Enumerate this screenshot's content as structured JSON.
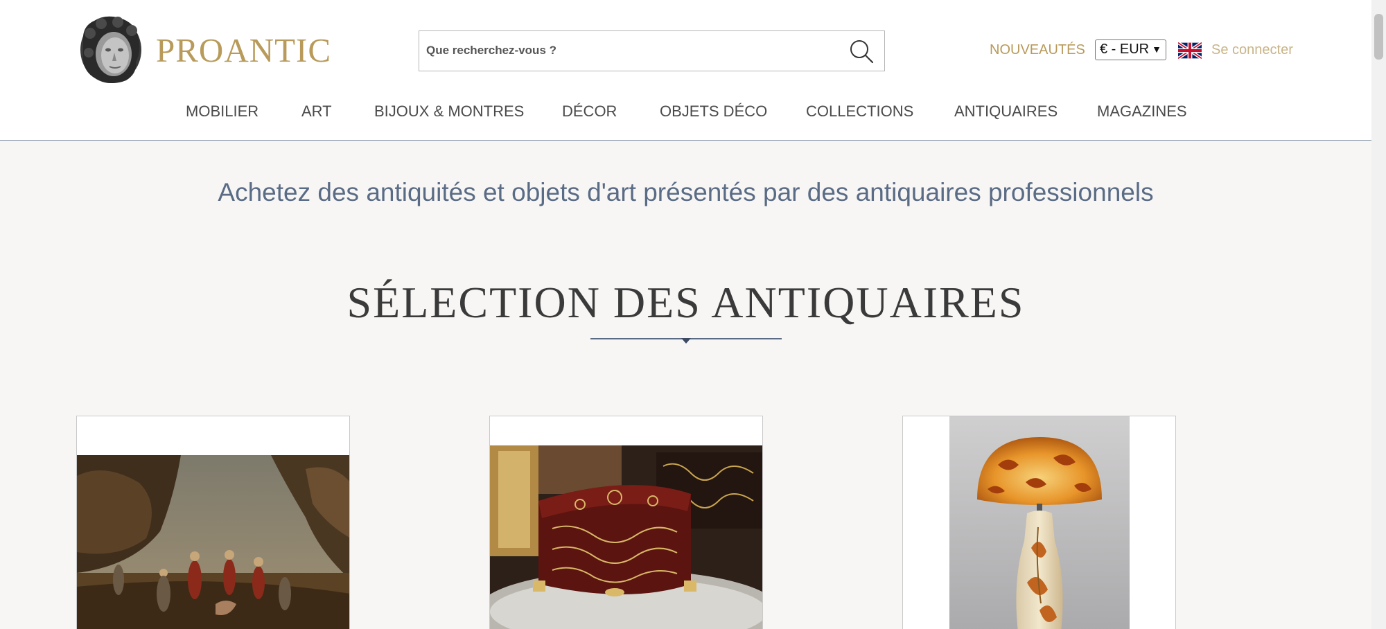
{
  "header": {
    "logo_text": "PROANTIC",
    "search_placeholder": "Que recherchez-vous ?",
    "new_label": "NOUVEAUTÉS",
    "currency_value": "€ - EUR",
    "login_label": "Se connecter",
    "icons": {
      "logo": "cherub-head-logo",
      "search": "search-icon",
      "flag": "uk-flag-icon",
      "select": "chevron-down-icon"
    }
  },
  "nav": {
    "items": [
      "MOBILIER",
      "ART",
      "BIJOUX & MONTRES",
      "DÉCOR",
      "OBJETS DÉCO",
      "COLLECTIONS",
      "ANTIQUAIRES",
      "MAGAZINES"
    ]
  },
  "main": {
    "tagline": "Achetez des antiquités et objets d'art présentés par des antiquaires professionnels",
    "section_title": "SÉLECTION DES ANTIQUAIRES",
    "cards": [
      {
        "name": "painting-card",
        "subject": "old master landscape painting"
      },
      {
        "name": "boulle-box-card",
        "subject": "boulle marquetry box"
      },
      {
        "name": "galle-lamp-card",
        "subject": "cameo glass mushroom lamp"
      }
    ]
  },
  "colors": {
    "brand_gold": "#b89a5a",
    "login_gold": "#c8b488",
    "tagline_blue": "#5a6b85",
    "background": "#f7f6f5"
  }
}
